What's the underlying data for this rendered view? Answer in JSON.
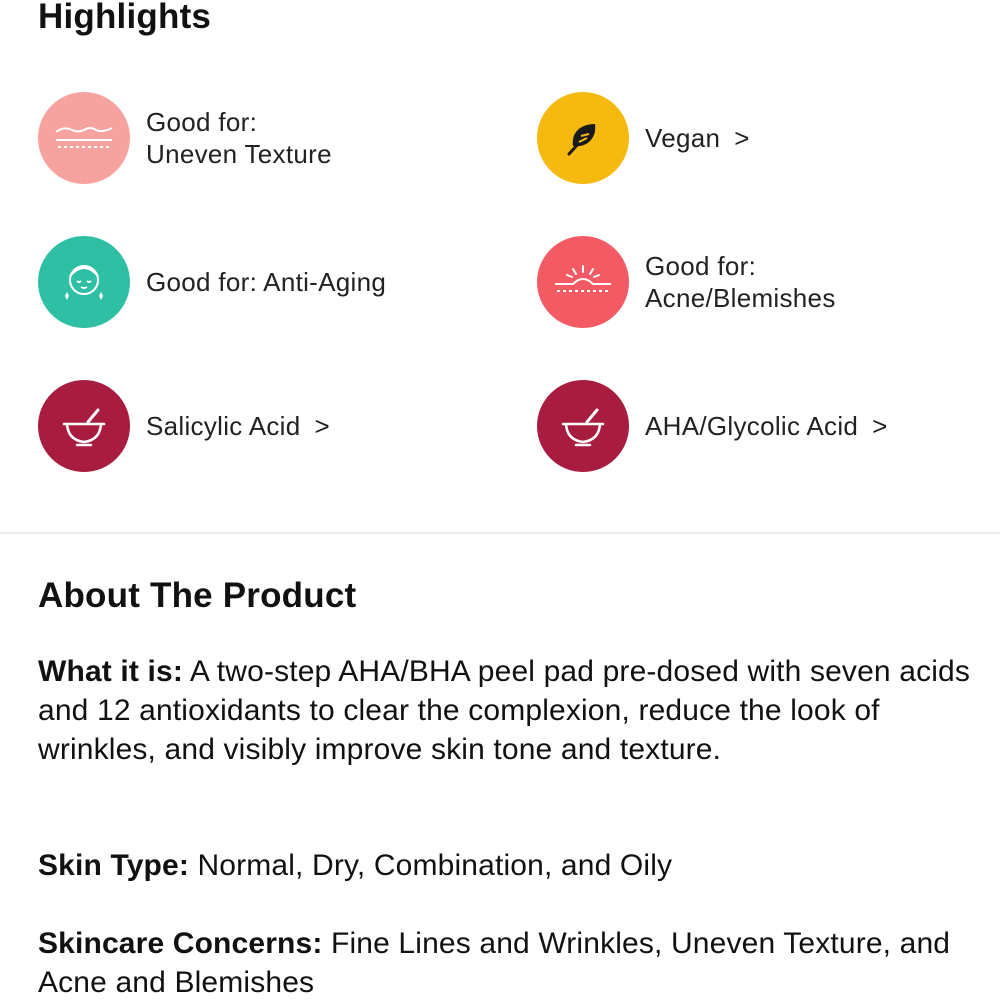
{
  "highlights": {
    "title": "Highlights",
    "items": [
      {
        "name": "uneven-texture",
        "line1": "Good for:",
        "line2": "Uneven Texture",
        "icon": "skin-layers-icon",
        "color": "#f6a3a0"
      },
      {
        "name": "vegan",
        "label": "Vegan",
        "chevron": ">",
        "icon": "leaf-icon",
        "color": "#f6b90f"
      },
      {
        "name": "anti-aging",
        "label": "Good for: Anti-Aging",
        "icon": "face-sparkle-icon",
        "color": "#2fbfa5"
      },
      {
        "name": "acne-blemishes",
        "line1": "Good for:",
        "line2": "Acne/Blemishes",
        "icon": "skin-blemish-icon",
        "color": "#f45a64"
      },
      {
        "name": "salicylic-acid",
        "label": "Salicylic Acid",
        "chevron": ">",
        "icon": "mortar-pestle-icon",
        "color": "#a81c40"
      },
      {
        "name": "aha-glycolic-acid",
        "label": "AHA/Glycolic Acid",
        "chevron": ">",
        "icon": "mortar-pestle-icon",
        "color": "#a81c40"
      }
    ]
  },
  "about": {
    "title": "About The Product",
    "what_it_is_label": "What it is:",
    "what_it_is_text": " A two-step AHA/BHA peel pad pre-dosed with seven acids and 12 antioxidants to clear the complexion, reduce the look of wrinkles, and visibly improve skin tone and texture.",
    "skin_type_label": "Skin Type:",
    "skin_type_text": " Normal, Dry, Combination, and Oily",
    "concerns_label": "Skincare Concerns:",
    "concerns_text": " Fine Lines and Wrinkles, Uneven Texture, and Acne and Blemishes"
  }
}
